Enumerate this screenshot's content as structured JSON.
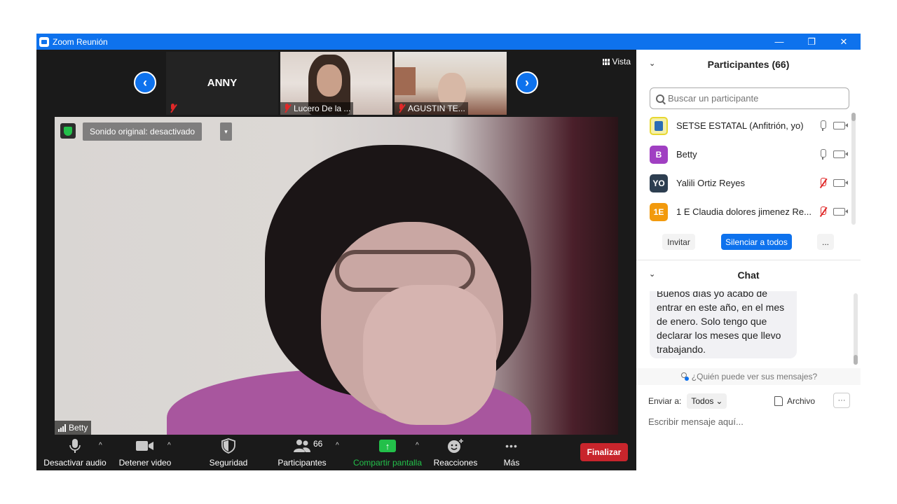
{
  "window": {
    "title": "Zoom Reunión",
    "controls": {
      "minimize": "—",
      "restore": "❐",
      "close": "✕"
    }
  },
  "thumbnails": {
    "prev_icon": "chevron-left-icon",
    "next_icon": "chevron-right-icon",
    "items": [
      {
        "name": "ANNY",
        "label": "",
        "muted": true
      },
      {
        "name": "",
        "label": "Lucero De la ...",
        "muted": true
      },
      {
        "name": "",
        "label": "AGUSTIN TE...",
        "muted": true
      }
    ],
    "view_label": "Vista"
  },
  "main_video": {
    "sound_label": "Sonido original: desactivado",
    "sound_caret": "▾",
    "speaker_name": "Betty"
  },
  "toolbar": {
    "audio_label": "Desactivar audio",
    "video_label": "Detener video",
    "security_label": "Seguridad",
    "participants_label": "Participantes",
    "participants_count": "66",
    "share_label": "Compartir pantalla",
    "reactions_label": "Reacciones",
    "more_label": "Más",
    "more_icon": "•••",
    "end_label": "Finalizar",
    "caret": "^"
  },
  "participants": {
    "header": "Participantes (66)",
    "search_placeholder": "Buscar un participante",
    "list": [
      {
        "name": "SETSE ESTATAL (Anfitrión, yo)",
        "initials": "",
        "color": "#ffe34d",
        "mic": "on"
      },
      {
        "name": "Betty",
        "initials": "B",
        "color": "#a03fc2",
        "mic": "on"
      },
      {
        "name": "Yalili Ortiz Reyes",
        "initials": "YO",
        "color": "#2d3e50",
        "mic": "off"
      },
      {
        "name": "1 E Claudia dolores jimenez Re...",
        "initials": "1E",
        "color": "#f29a0d",
        "mic": "off"
      }
    ],
    "invite_label": "Invitar",
    "mute_all_label": "Silenciar a todos",
    "more_label": "..."
  },
  "chat": {
    "header": "Chat",
    "message": "Buenos días yo acabo de entrar en este año, en el mes de enero. Solo tengo que declarar los meses que llevo trabajando.",
    "privacy_label": "¿Quién puede ver sus mensajes?",
    "send_to_label": "Enviar a:",
    "send_to_value": "Todos",
    "file_label": "Archivo",
    "more_label": "···",
    "input_placeholder": "Escribir mensaje aquí..."
  },
  "colors": {
    "accent": "#0e72ed",
    "end_red": "#c8252c",
    "share_green": "#23c04a",
    "muted_red": "#e02828"
  }
}
